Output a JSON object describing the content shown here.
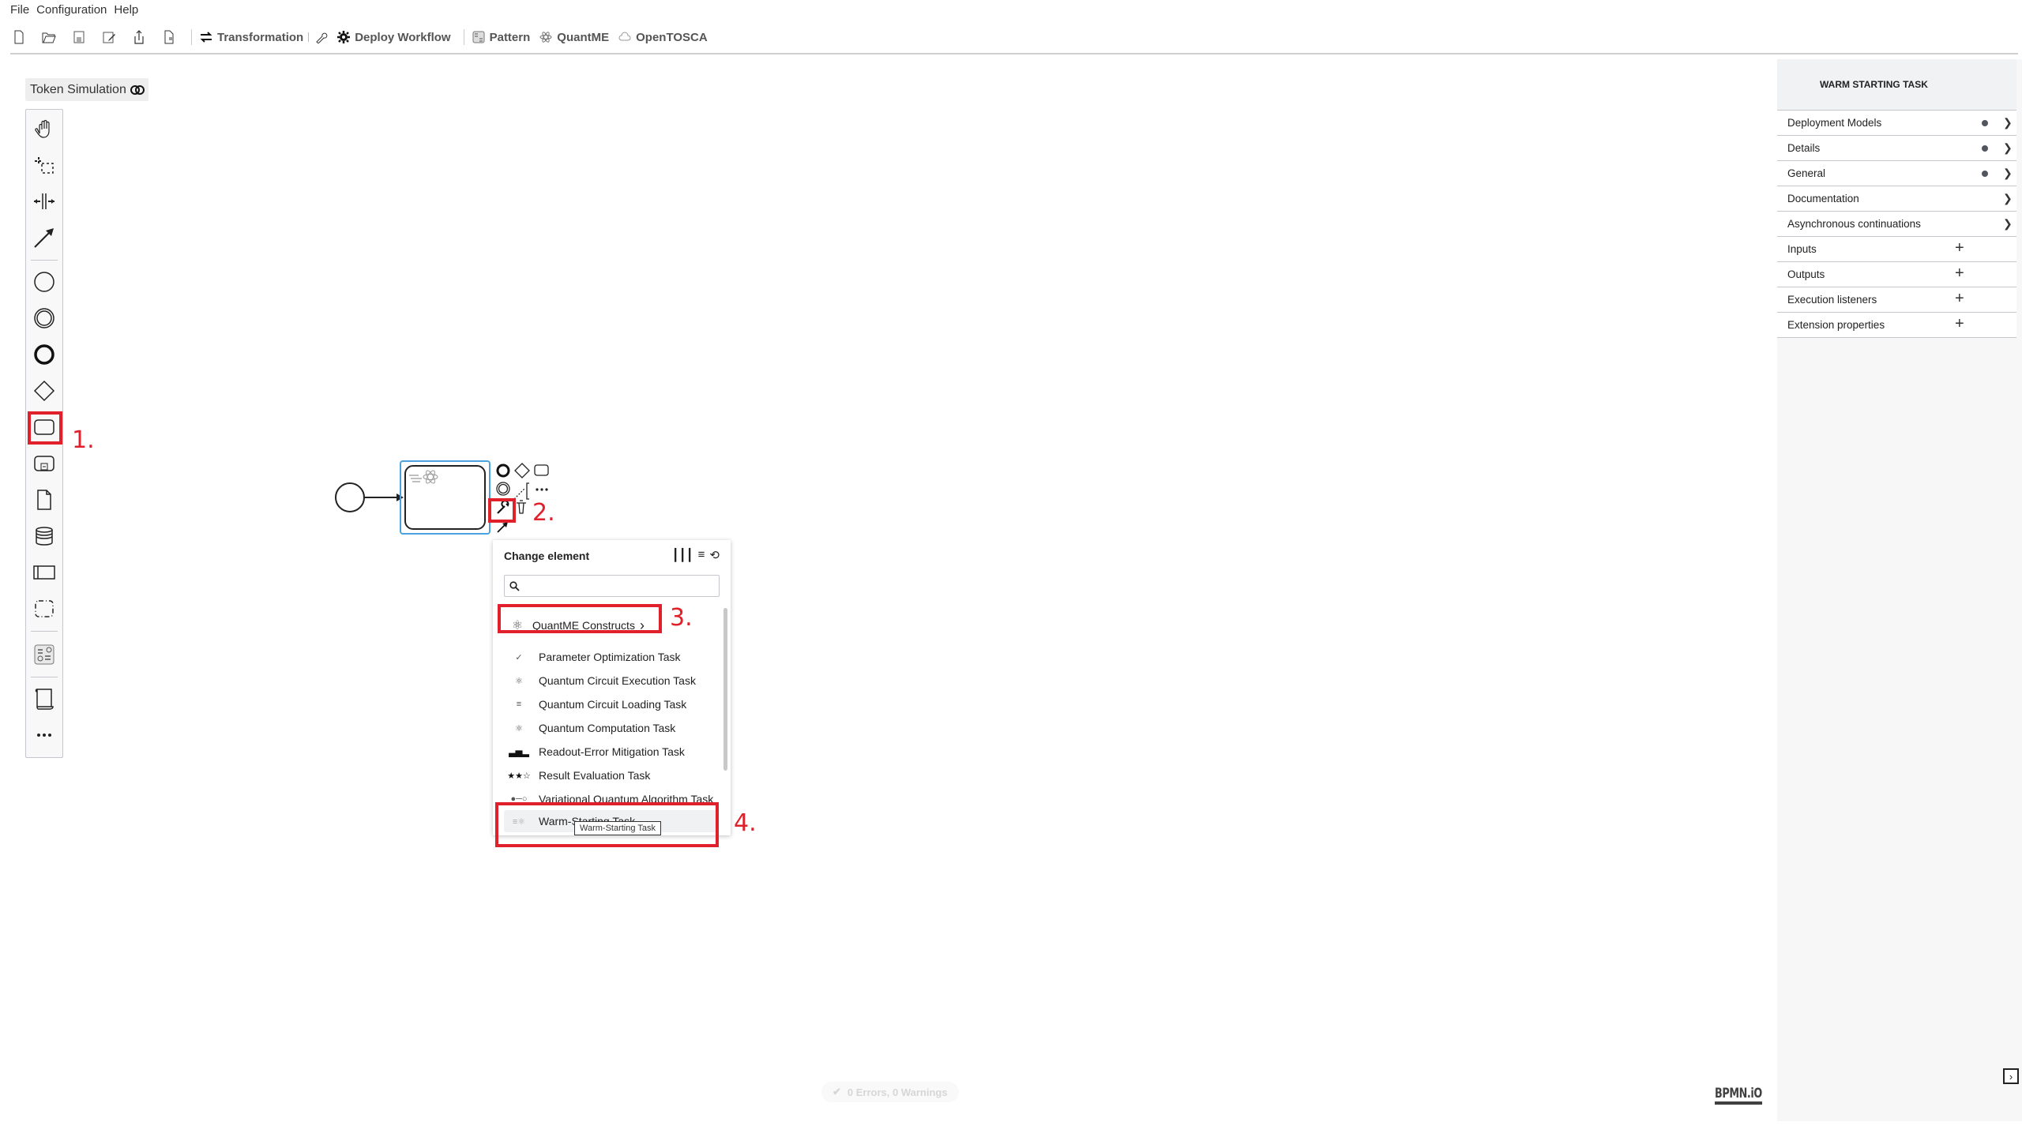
{
  "menu": {
    "items": [
      "File",
      "Configuration",
      "Help"
    ]
  },
  "toolbar": {
    "icons": [
      "new-file-icon",
      "open-folder-icon",
      "save-icon",
      "save-as-icon",
      "upload-icon",
      "export-icon"
    ],
    "transformation_label": "Transformation",
    "deploy_label": "Deploy Workflow",
    "pattern_label": "Pattern",
    "quantme_label": "QuantME",
    "opentosca_label": "OpenTOSCA"
  },
  "token_simulation": {
    "label": "Token Simulation"
  },
  "palette": {
    "tools": [
      "hand-tool",
      "lasso-tool",
      "space-tool",
      "global-connect-tool"
    ],
    "elements": [
      "start-event",
      "intermediate-event",
      "end-event",
      "gateway",
      "task",
      "subprocess",
      "data-object",
      "data-store",
      "pool",
      "group"
    ],
    "extras": [
      "pattern-selection",
      "quantme-data-map",
      "more"
    ]
  },
  "annotations": {
    "one": "1.",
    "two": "2.",
    "three": "3.",
    "four": "4.",
    "color": "#e0202a"
  },
  "popup": {
    "title": "Change element",
    "search_value": "",
    "group_entry": "QuantME Constructs",
    "entries": [
      {
        "label": "Parameter Optimization Task",
        "icon": "parameter-optimization-icon"
      },
      {
        "label": "Quantum Circuit Execution Task",
        "icon": "circuit-execution-icon"
      },
      {
        "label": "Quantum Circuit Loading Task",
        "icon": "circuit-loading-icon"
      },
      {
        "label": "Quantum Computation Task",
        "icon": "quantum-computation-icon"
      },
      {
        "label": "Readout-Error Mitigation Task",
        "icon": "readout-mitigation-icon"
      },
      {
        "label": "Result Evaluation Task",
        "icon": "result-evaluation-icon"
      },
      {
        "label": "Variational Quantum Algorithm Task",
        "icon": "vqa-icon"
      },
      {
        "label": "Warm-Starting Task",
        "icon": "warm-starting-icon"
      }
    ],
    "tooltip": "Warm-Starting Task"
  },
  "properties": {
    "title": "WARM STARTING TASK",
    "groups": [
      {
        "label": "Deployment Models",
        "dot": true,
        "kind": "chevron"
      },
      {
        "label": "Details",
        "dot": true,
        "kind": "chevron"
      },
      {
        "label": "General",
        "dot": true,
        "kind": "chevron"
      },
      {
        "label": "Documentation",
        "dot": false,
        "kind": "chevron"
      },
      {
        "label": "Asynchronous continuations",
        "dot": false,
        "kind": "chevron"
      },
      {
        "label": "Inputs",
        "dot": false,
        "kind": "plus"
      },
      {
        "label": "Outputs",
        "dot": false,
        "kind": "plus"
      },
      {
        "label": "Execution listeners",
        "dot": false,
        "kind": "plus"
      },
      {
        "label": "Extension properties",
        "dot": false,
        "kind": "plus"
      }
    ]
  },
  "status": {
    "label": "0 Errors, 0 Warnings"
  },
  "logo": {
    "text": "BPMN.iO"
  },
  "colors": {
    "selection": "#4aa3df",
    "annotation": "#e0202a",
    "panel_bg": "#f7f7f8"
  }
}
